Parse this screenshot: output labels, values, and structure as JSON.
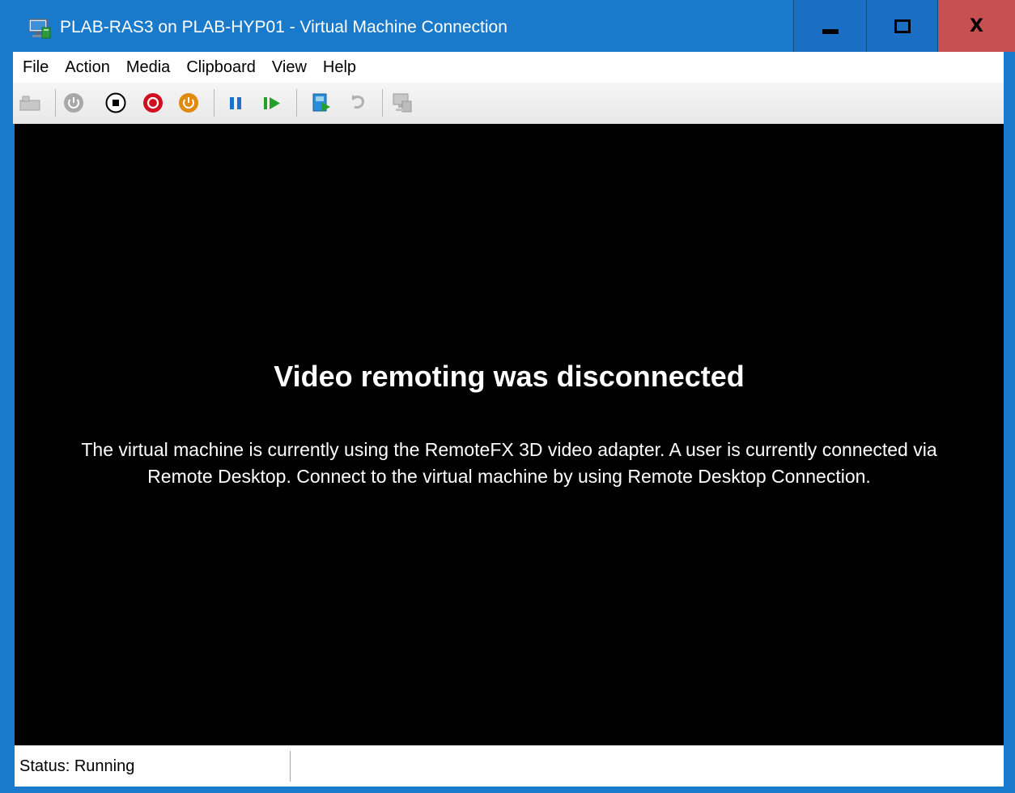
{
  "window": {
    "title": "PLAB-RAS3 on PLAB-HYP01 - Virtual Machine Connection",
    "app_icon": "vm-connection-icon",
    "controls": {
      "minimize_icon": "minimize-icon",
      "maximize_icon": "maximize-icon",
      "close_label": "X"
    }
  },
  "menu": {
    "items": [
      {
        "label": "File"
      },
      {
        "label": "Action"
      },
      {
        "label": "Media"
      },
      {
        "label": "Clipboard"
      },
      {
        "label": "View"
      },
      {
        "label": "Help"
      }
    ]
  },
  "toolbar": {
    "buttons": [
      {
        "icon": "ctrl-alt-del-icon",
        "enabled": false
      },
      {
        "icon": "start-icon",
        "enabled": false
      },
      {
        "icon": "turn-off-icon",
        "enabled": true,
        "color": "#000000"
      },
      {
        "icon": "shut-down-icon",
        "enabled": true,
        "color": "#d01020"
      },
      {
        "icon": "save-icon",
        "enabled": true,
        "color": "#e08a10"
      },
      {
        "icon": "pause-icon",
        "enabled": true,
        "color": "#1a73d0"
      },
      {
        "icon": "resume-icon",
        "enabled": true,
        "color": "#22a02a"
      },
      {
        "icon": "checkpoint-icon",
        "enabled": true
      },
      {
        "icon": "revert-icon",
        "enabled": false
      },
      {
        "icon": "enhanced-session-icon",
        "enabled": false
      }
    ]
  },
  "viewport": {
    "heading": "Video remoting was disconnected",
    "message": "The virtual machine is currently using the RemoteFX 3D video adapter. A user is currently connected via Remote Desktop. Connect to the virtual machine by using Remote Desktop Connection."
  },
  "status": {
    "text": "Status: Running"
  },
  "colors": {
    "frame": "#1979ca",
    "close_button": "#c75050",
    "viewport_bg": "#000000"
  }
}
